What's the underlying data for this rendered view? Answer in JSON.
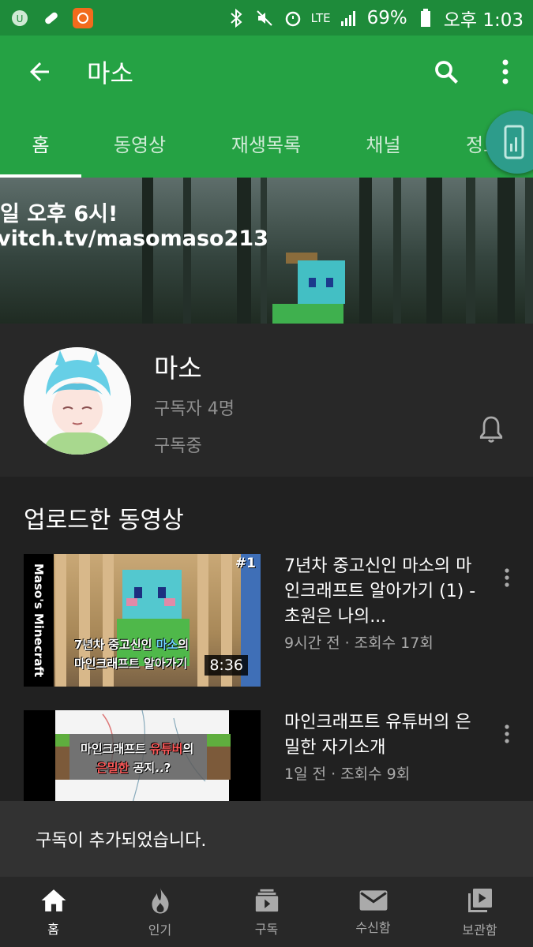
{
  "status_bar": {
    "network": "LTE",
    "battery": "69%",
    "time": "오후 1:03"
  },
  "app_bar": {
    "title": "마소"
  },
  "tabs": [
    {
      "label": "홈"
    },
    {
      "label": "동영상"
    },
    {
      "label": "재생목록"
    },
    {
      "label": "채널"
    },
    {
      "label": "정보"
    }
  ],
  "banner": {
    "line1": "일 오후 6시!",
    "line2": "vitch.tv/masomaso213"
  },
  "channel": {
    "name": "마소",
    "subscribers": "구독자 4명",
    "subscribed_label": "구독중"
  },
  "section": {
    "title": "업로드한 동영상"
  },
  "videos": [
    {
      "title": "7년차 중고신인 마소의 마인크래프트 알아가기 (1) - 초원은 나의...",
      "meta": "9시간 전 · 조회수 17회",
      "duration": "8:36",
      "thumb_label": "Maso's Minecraft",
      "thumb_badge": "#1",
      "thumb_caption_1a": "7년차 중고신인 ",
      "thumb_caption_1b": "마소",
      "thumb_caption_1c": "의",
      "thumb_caption_2": "마인크래프트 알아가기"
    },
    {
      "title": "마인크래프트 유튜버의 은밀한 자기소개",
      "meta": "1일 전 · 조회수 9회",
      "thumb_caption_1a": "마인크래프트 ",
      "thumb_caption_1b": "유튜버",
      "thumb_caption_1c": "의",
      "thumb_caption_2a": "은밀한",
      "thumb_caption_2b": " 공지..?"
    }
  ],
  "snackbar": {
    "message": "구독이 추가되었습니다."
  },
  "bottom_nav": [
    {
      "label": "홈",
      "icon": "home-icon"
    },
    {
      "label": "인기",
      "icon": "fire-icon"
    },
    {
      "label": "구독",
      "icon": "subscriptions-icon"
    },
    {
      "label": "수신함",
      "icon": "mail-icon"
    },
    {
      "label": "보관함",
      "icon": "library-icon"
    }
  ],
  "colors": {
    "status_bar": "#1e8b3a",
    "app_bar": "#25a244",
    "background": "#212121",
    "channel_bg": "#282828",
    "snackbar": "#323232"
  }
}
